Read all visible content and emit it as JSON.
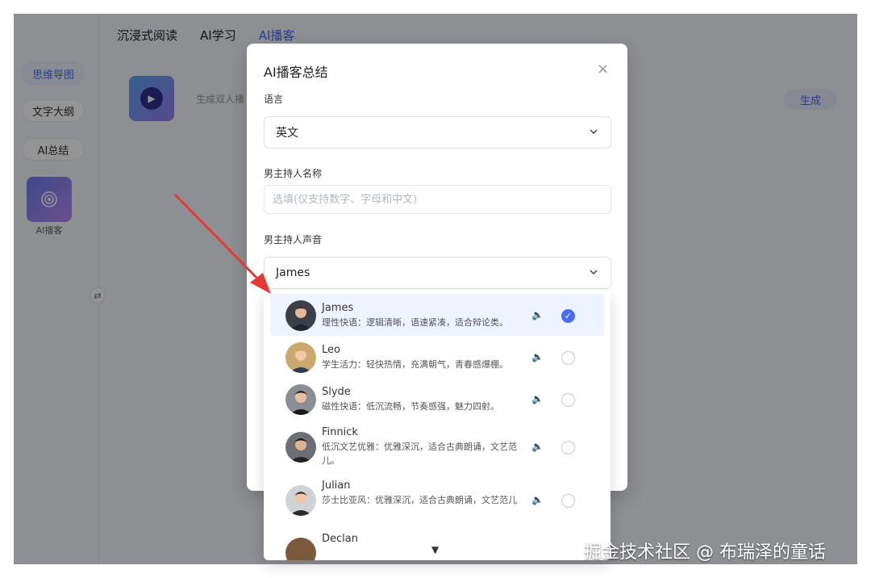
{
  "top_tabs": [
    "沉浸式阅读",
    "AI学习",
    "AI播客"
  ],
  "left_rail": {
    "items": [
      "思维导图",
      "文字大纲",
      "AI总结"
    ],
    "podcast_label": "AI播客"
  },
  "card": {
    "desc": "生成双人播",
    "generate_label": "生成"
  },
  "modal": {
    "title": "AI播客总结",
    "close_label": "×",
    "language_label": "语言",
    "language_value": "英文",
    "host_name_label": "男主持人名称",
    "host_name_placeholder": "选填(仅支持数字、字母和中文)",
    "host_voice_label": "男主持人声音",
    "host_voice_value": "James"
  },
  "voices": [
    {
      "name": "James",
      "desc": "理性快语：逻辑清晰，语速紧凑，适合辩论类。",
      "selected": true
    },
    {
      "name": "Leo",
      "desc": "学生活力：轻快热情，充满朝气，青春感爆棚。",
      "selected": false
    },
    {
      "name": "Slyde",
      "desc": "磁性快语：低沉流畅，节奏感强，魅力四射。",
      "selected": false
    },
    {
      "name": "Finnick",
      "desc": "低沉文艺优雅：优雅深沉，适合古典朗诵，文艺范儿。",
      "selected": false
    },
    {
      "name": "Julian",
      "desc": "莎士比亚风：优雅深沉，适合古典朗诵，文艺范儿",
      "selected": false
    },
    {
      "name": "Declan",
      "desc": "",
      "selected": false
    }
  ],
  "icons": {
    "speaker": "🔈",
    "check": "✓",
    "chevron": "⌄",
    "scroll_down": "▼",
    "toggle": "⇄"
  },
  "watermark": "掘金技术社区 @ 布瑞泽的童话",
  "colors": {
    "accent": "#4b6cf0",
    "annotation_arrow": "#e53935"
  }
}
